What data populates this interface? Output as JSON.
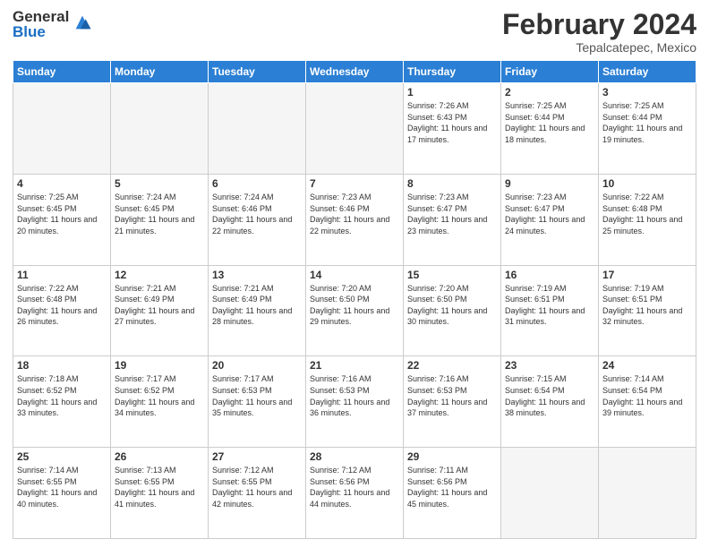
{
  "logo": {
    "general": "General",
    "blue": "Blue"
  },
  "title": "February 2024",
  "location": "Tepalcatepec, Mexico",
  "days_of_week": [
    "Sunday",
    "Monday",
    "Tuesday",
    "Wednesday",
    "Thursday",
    "Friday",
    "Saturday"
  ],
  "weeks": [
    [
      {
        "day": "",
        "empty": true
      },
      {
        "day": "",
        "empty": true
      },
      {
        "day": "",
        "empty": true
      },
      {
        "day": "",
        "empty": true
      },
      {
        "day": "1",
        "sunrise": "7:26 AM",
        "sunset": "6:43 PM",
        "daylight": "11 hours and 17 minutes."
      },
      {
        "day": "2",
        "sunrise": "7:25 AM",
        "sunset": "6:44 PM",
        "daylight": "11 hours and 18 minutes."
      },
      {
        "day": "3",
        "sunrise": "7:25 AM",
        "sunset": "6:44 PM",
        "daylight": "11 hours and 19 minutes."
      }
    ],
    [
      {
        "day": "4",
        "sunrise": "7:25 AM",
        "sunset": "6:45 PM",
        "daylight": "11 hours and 20 minutes."
      },
      {
        "day": "5",
        "sunrise": "7:24 AM",
        "sunset": "6:45 PM",
        "daylight": "11 hours and 21 minutes."
      },
      {
        "day": "6",
        "sunrise": "7:24 AM",
        "sunset": "6:46 PM",
        "daylight": "11 hours and 22 minutes."
      },
      {
        "day": "7",
        "sunrise": "7:23 AM",
        "sunset": "6:46 PM",
        "daylight": "11 hours and 22 minutes."
      },
      {
        "day": "8",
        "sunrise": "7:23 AM",
        "sunset": "6:47 PM",
        "daylight": "11 hours and 23 minutes."
      },
      {
        "day": "9",
        "sunrise": "7:23 AM",
        "sunset": "6:47 PM",
        "daylight": "11 hours and 24 minutes."
      },
      {
        "day": "10",
        "sunrise": "7:22 AM",
        "sunset": "6:48 PM",
        "daylight": "11 hours and 25 minutes."
      }
    ],
    [
      {
        "day": "11",
        "sunrise": "7:22 AM",
        "sunset": "6:48 PM",
        "daylight": "11 hours and 26 minutes."
      },
      {
        "day": "12",
        "sunrise": "7:21 AM",
        "sunset": "6:49 PM",
        "daylight": "11 hours and 27 minutes."
      },
      {
        "day": "13",
        "sunrise": "7:21 AM",
        "sunset": "6:49 PM",
        "daylight": "11 hours and 28 minutes."
      },
      {
        "day": "14",
        "sunrise": "7:20 AM",
        "sunset": "6:50 PM",
        "daylight": "11 hours and 29 minutes."
      },
      {
        "day": "15",
        "sunrise": "7:20 AM",
        "sunset": "6:50 PM",
        "daylight": "11 hours and 30 minutes."
      },
      {
        "day": "16",
        "sunrise": "7:19 AM",
        "sunset": "6:51 PM",
        "daylight": "11 hours and 31 minutes."
      },
      {
        "day": "17",
        "sunrise": "7:19 AM",
        "sunset": "6:51 PM",
        "daylight": "11 hours and 32 minutes."
      }
    ],
    [
      {
        "day": "18",
        "sunrise": "7:18 AM",
        "sunset": "6:52 PM",
        "daylight": "11 hours and 33 minutes."
      },
      {
        "day": "19",
        "sunrise": "7:17 AM",
        "sunset": "6:52 PM",
        "daylight": "11 hours and 34 minutes."
      },
      {
        "day": "20",
        "sunrise": "7:17 AM",
        "sunset": "6:53 PM",
        "daylight": "11 hours and 35 minutes."
      },
      {
        "day": "21",
        "sunrise": "7:16 AM",
        "sunset": "6:53 PM",
        "daylight": "11 hours and 36 minutes."
      },
      {
        "day": "22",
        "sunrise": "7:16 AM",
        "sunset": "6:53 PM",
        "daylight": "11 hours and 37 minutes."
      },
      {
        "day": "23",
        "sunrise": "7:15 AM",
        "sunset": "6:54 PM",
        "daylight": "11 hours and 38 minutes."
      },
      {
        "day": "24",
        "sunrise": "7:14 AM",
        "sunset": "6:54 PM",
        "daylight": "11 hours and 39 minutes."
      }
    ],
    [
      {
        "day": "25",
        "sunrise": "7:14 AM",
        "sunset": "6:55 PM",
        "daylight": "11 hours and 40 minutes."
      },
      {
        "day": "26",
        "sunrise": "7:13 AM",
        "sunset": "6:55 PM",
        "daylight": "11 hours and 41 minutes."
      },
      {
        "day": "27",
        "sunrise": "7:12 AM",
        "sunset": "6:55 PM",
        "daylight": "11 hours and 42 minutes."
      },
      {
        "day": "28",
        "sunrise": "7:12 AM",
        "sunset": "6:56 PM",
        "daylight": "11 hours and 44 minutes."
      },
      {
        "day": "29",
        "sunrise": "7:11 AM",
        "sunset": "6:56 PM",
        "daylight": "11 hours and 45 minutes."
      },
      {
        "day": "",
        "empty": true
      },
      {
        "day": "",
        "empty": true
      }
    ]
  ]
}
